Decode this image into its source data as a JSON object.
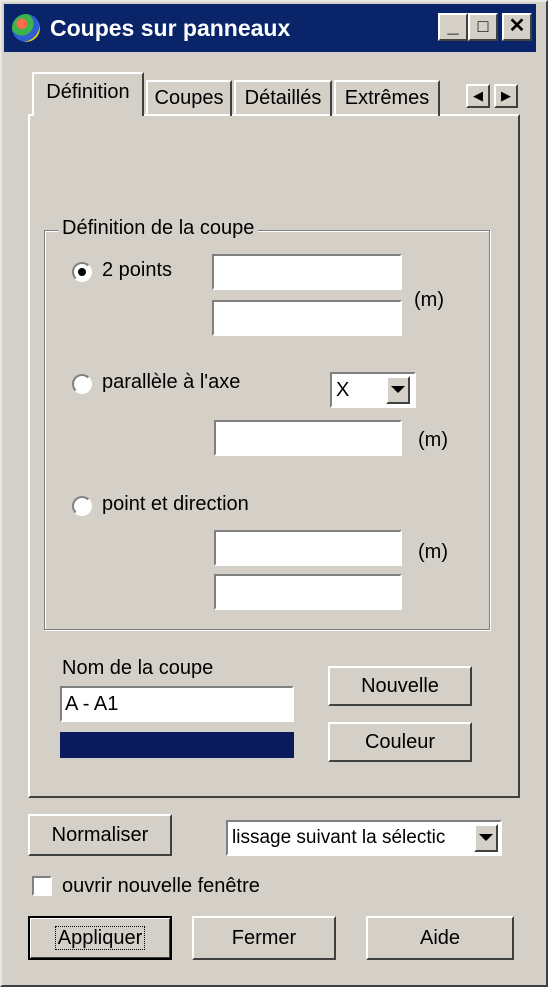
{
  "window": {
    "title": "Coupes sur panneaux",
    "icon": "globe-icon"
  },
  "title_buttons": {
    "minimize": "_",
    "maximize": "□",
    "close": "✕"
  },
  "tabs": [
    {
      "label": "Définition",
      "active": true
    },
    {
      "label": "Coupes"
    },
    {
      "label": "Détaillés"
    },
    {
      "label": "Extrêmes"
    }
  ],
  "tab_scroll": {
    "left": "◀",
    "right": "▶"
  },
  "group": {
    "title": "Définition de la coupe",
    "options": {
      "two_points": {
        "label": "2 points",
        "checked": true,
        "unit": "(m)"
      },
      "parallel_axis": {
        "label": "parallèle à l'axe",
        "checked": false,
        "axis_value": "X",
        "unit": "(m)"
      },
      "point_direction": {
        "label": "point et direction",
        "checked": false,
        "unit": "(m)"
      }
    }
  },
  "cut_name": {
    "label": "Nom de la coupe",
    "value": "A - A1",
    "color": "#0a1a5c"
  },
  "buttons": {
    "new": "Nouvelle",
    "color": "Couleur",
    "normalize": "Normaliser",
    "apply": "Appliquer",
    "close": "Fermer",
    "help": "Aide"
  },
  "smoothing": {
    "value": "lissage suivant la sélectic"
  },
  "open_new_window": {
    "label": "ouvrir nouvelle fenêtre",
    "checked": false
  }
}
